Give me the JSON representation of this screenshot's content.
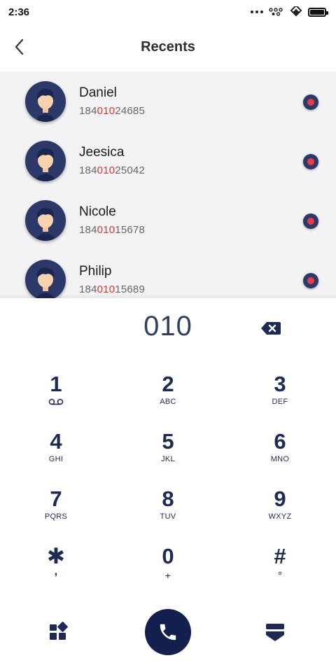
{
  "status_bar": {
    "time": "2:36"
  },
  "header": {
    "title": "Recents"
  },
  "recents": [
    {
      "name": "Daniel",
      "number_prefix": "184",
      "number_match": "010",
      "number_suffix": "24685"
    },
    {
      "name": "Jeesica",
      "number_prefix": "184",
      "number_match": "010",
      "number_suffix": "25042"
    },
    {
      "name": "Nicole",
      "number_prefix": "184",
      "number_match": "010",
      "number_suffix": "15678"
    },
    {
      "name": "Philip",
      "number_prefix": "184",
      "number_match": "010",
      "number_suffix": "15689"
    }
  ],
  "dialer": {
    "value": "010",
    "keys": [
      {
        "digit": "1",
        "letters": "",
        "sub_icon": "voicemail-icon"
      },
      {
        "digit": "2",
        "letters": "ABC"
      },
      {
        "digit": "3",
        "letters": "DEF"
      },
      {
        "digit": "4",
        "letters": "GHI"
      },
      {
        "digit": "5",
        "letters": "JKL"
      },
      {
        "digit": "6",
        "letters": "MNO"
      },
      {
        "digit": "7",
        "letters": "PQRS"
      },
      {
        "digit": "8",
        "letters": "TUV"
      },
      {
        "digit": "9",
        "letters": "WXYZ"
      },
      {
        "digit": "✱",
        "letters": ","
      },
      {
        "digit": "0",
        "letters": "+"
      },
      {
        "digit": "#",
        "letters": "°"
      }
    ]
  },
  "colors": {
    "primary": "#1e2a52",
    "match_highlight": "#e4322b",
    "record_dot": "#e83a4a",
    "call_button": "#13204d",
    "list_background": "#f3f3f5"
  },
  "icons": {
    "back": "chevron-left-icon",
    "backspace": "backspace-icon",
    "grid": "grid-icon",
    "call": "phone-icon",
    "hide_keypad": "hide-keypad-icon",
    "record": "record-dot-icon",
    "avatar": "avatar-icon"
  }
}
